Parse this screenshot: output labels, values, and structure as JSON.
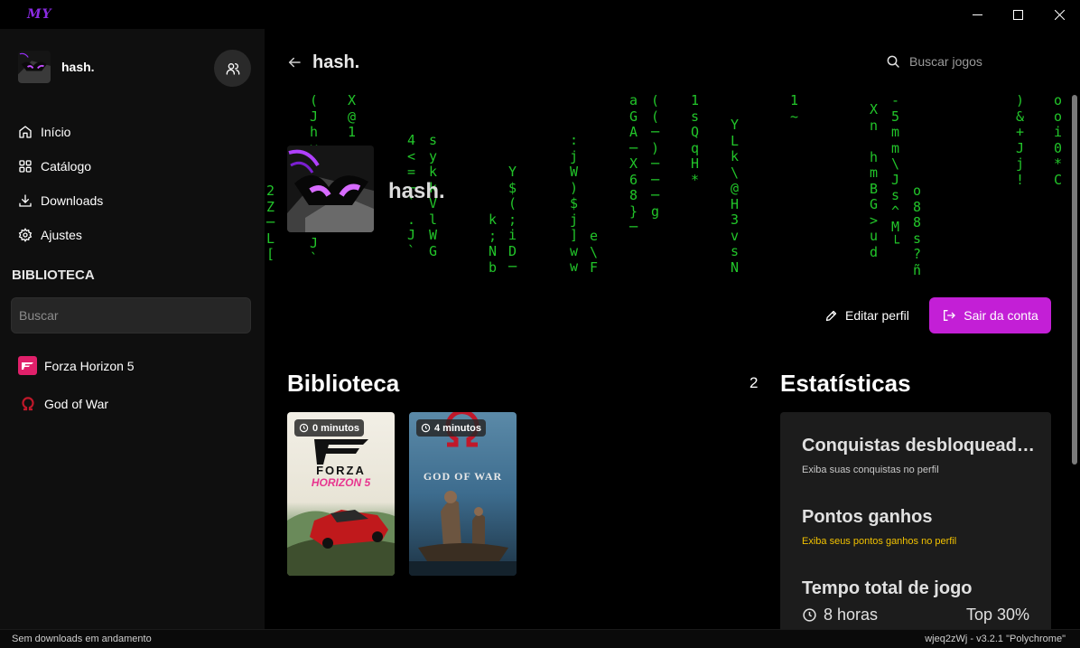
{
  "app": {
    "logo_text": "MY"
  },
  "window_controls": [
    "minimize",
    "maximize",
    "close"
  ],
  "sidebar": {
    "profile_name": "hash.",
    "nav": [
      {
        "label": "Início",
        "icon": "home-icon"
      },
      {
        "label": "Catálogo",
        "icon": "grid-icon"
      },
      {
        "label": "Downloads",
        "icon": "download-icon"
      },
      {
        "label": "Ajustes",
        "icon": "gear-icon"
      }
    ],
    "library_title": "BIBLIOTECA",
    "search_placeholder": "Buscar",
    "games": [
      {
        "name": "Forza Horizon 5",
        "icon": "forza-icon",
        "color": "#e0206a"
      },
      {
        "name": "God of War",
        "icon": "god-of-war-icon",
        "color": "#c0182a"
      }
    ]
  },
  "header": {
    "title": "hash.",
    "search_placeholder": "Buscar jogos"
  },
  "hero": {
    "name": "hash."
  },
  "actions": {
    "edit_label": "Editar perfil",
    "logout_label": "Sair da conta",
    "logout_color": "#c31fd6"
  },
  "library": {
    "title": "Biblioteca",
    "count": "2",
    "games": [
      {
        "name": "Forza Horizon 5",
        "cover_text_1": "FORZA",
        "cover_text_2": "HORIZON 5",
        "playtime": "0 minutos"
      },
      {
        "name": "God of War",
        "cover_text_1": "GOD OF WAR",
        "playtime": "4 minutos"
      }
    ]
  },
  "stats": {
    "title": "Estatísticas",
    "items": [
      {
        "title": "Conquistas desbloqueadas",
        "subtitle": "Exiba suas conquistas no perfil"
      },
      {
        "title": "Pontos ganhos",
        "subtitle": "Exiba seus pontos ganhos no perfil",
        "subtitle_color": "#f2c200"
      },
      {
        "title": "Tempo total de jogo",
        "value": "8 horas",
        "rank": "Top 30%"
      }
    ]
  },
  "statusbar": {
    "left": "Sem downloads em andamento",
    "right": "wjeq2zWj - v3.2.1 \"Polychrome\""
  },
  "matrix_color": "#22c52a"
}
